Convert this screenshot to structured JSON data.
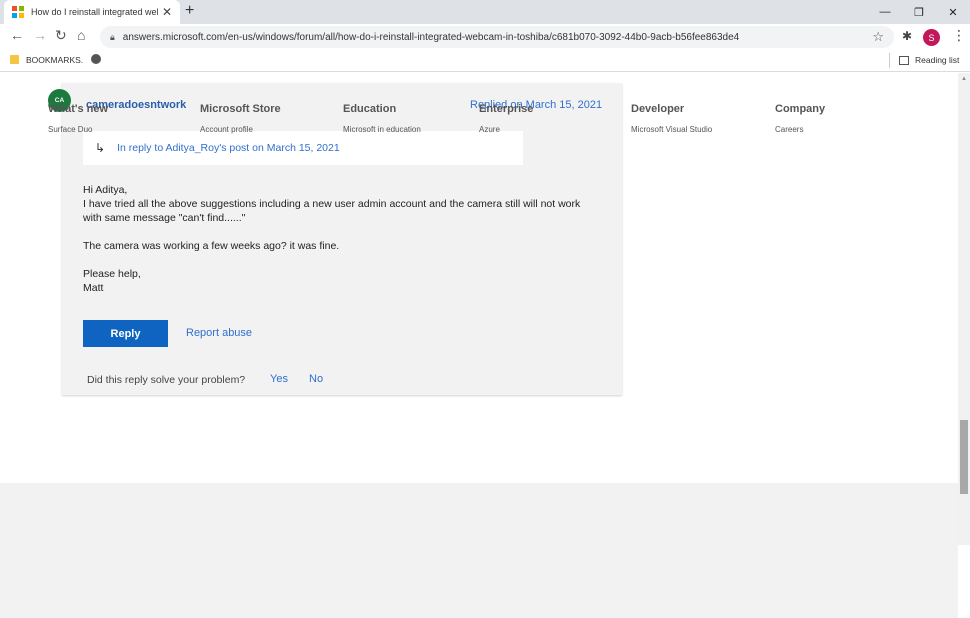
{
  "browser": {
    "tab_title": "How do I reinstall integrated web",
    "tab_close": "✕",
    "new_tab": "+",
    "url": "answers.microsoft.com/en-us/windows/forum/all/how-do-i-reinstall-integrated-webcam-in-toshiba/c681b070-3092-44b0-9acb-b56fee863de4",
    "profile_initial": "S",
    "bookmarks_label": "BOOKMARKS.",
    "reading_list": "Reading list",
    "ms_logo_colors": [
      "#f25022",
      "#7fba00",
      "#00a4ef",
      "#ffb900"
    ]
  },
  "post": {
    "avatar_initials": "CA",
    "username": "cameradoesntwork",
    "replied": "Replied on March 15, 2021",
    "in_reply_to": "In reply to Aditya_Roy's post on March 15, 2021",
    "body": {
      "greeting": "Hi Aditya,",
      "line1": "I have tried all the above suggestions including a new user admin account and the camera still will not work",
      "line2": "with same message \"can't find......\"",
      "line3": "The camera was working a few weeks ago?  it was fine.",
      "line4": "Please help,",
      "line5": "Matt"
    },
    "reply_button": "Reply",
    "report_abuse": "Report abuse",
    "solve_question": "Did this reply solve your problem?",
    "yes": "Yes",
    "no": "No"
  },
  "footer": {
    "columns": [
      {
        "heading": "What's new",
        "item": "Surface Duo"
      },
      {
        "heading": "Microsoft Store",
        "item": "Account profile"
      },
      {
        "heading": "Education",
        "item": "Microsoft in education"
      },
      {
        "heading": "Enterprise",
        "item": "Azure"
      },
      {
        "heading": "Developer",
        "item": "Microsoft Visual Studio"
      },
      {
        "heading": "Company",
        "item": "Careers"
      }
    ]
  }
}
